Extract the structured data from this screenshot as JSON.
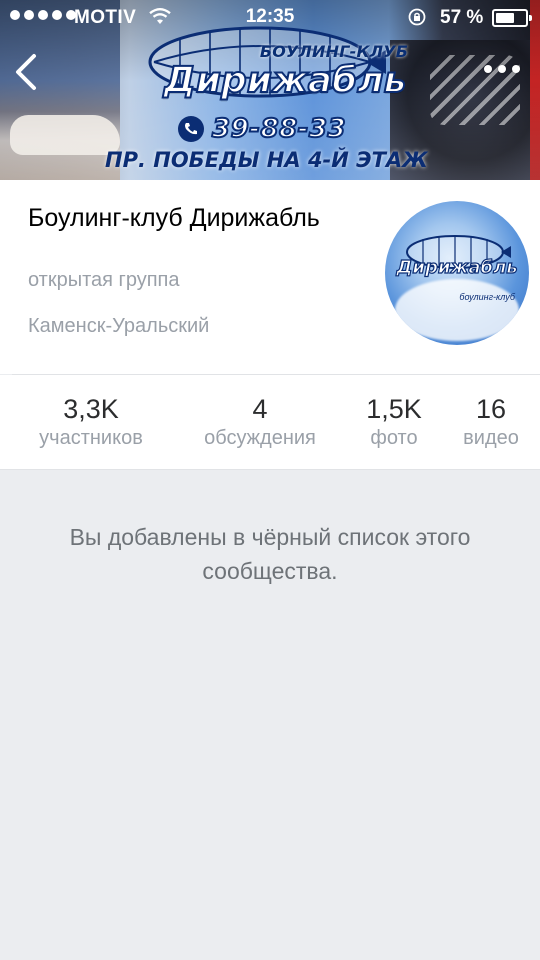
{
  "status_bar": {
    "carrier": "MOTIV",
    "time": "12:35",
    "battery_percent": "57 %",
    "battery_level": 0.57,
    "signal_bars": 5
  },
  "cover": {
    "brand_top": "БОУЛИНГ-КЛУБ",
    "brand_main": "Дирижабль",
    "phone": "39-88-33",
    "address": "ПР. ПОБЕДЫ НА 4-Й ЭТАЖ"
  },
  "nav": {
    "back_icon": "chevron-left-icon",
    "more_icon": "more-dots-icon"
  },
  "group": {
    "name": "Боулинг-клуб Дирижабль",
    "type": "открытая группа",
    "city": "Каменск-Уральский",
    "avatar_title": "Дирижабль",
    "avatar_sub": "боулинг-клуб"
  },
  "counters": [
    {
      "value": "3,3K",
      "label": "участников"
    },
    {
      "value": "4",
      "label": "обсуждения"
    },
    {
      "value": "1,5K",
      "label": "фото"
    },
    {
      "value": "16",
      "label": "видео"
    }
  ],
  "message": "Вы добавлены в чёрный список этого сообщества.",
  "colors": {
    "background": "#ebedf0",
    "card": "#ffffff",
    "secondary_text": "#9aa0a8",
    "brand_navy": "#0b2d74"
  }
}
